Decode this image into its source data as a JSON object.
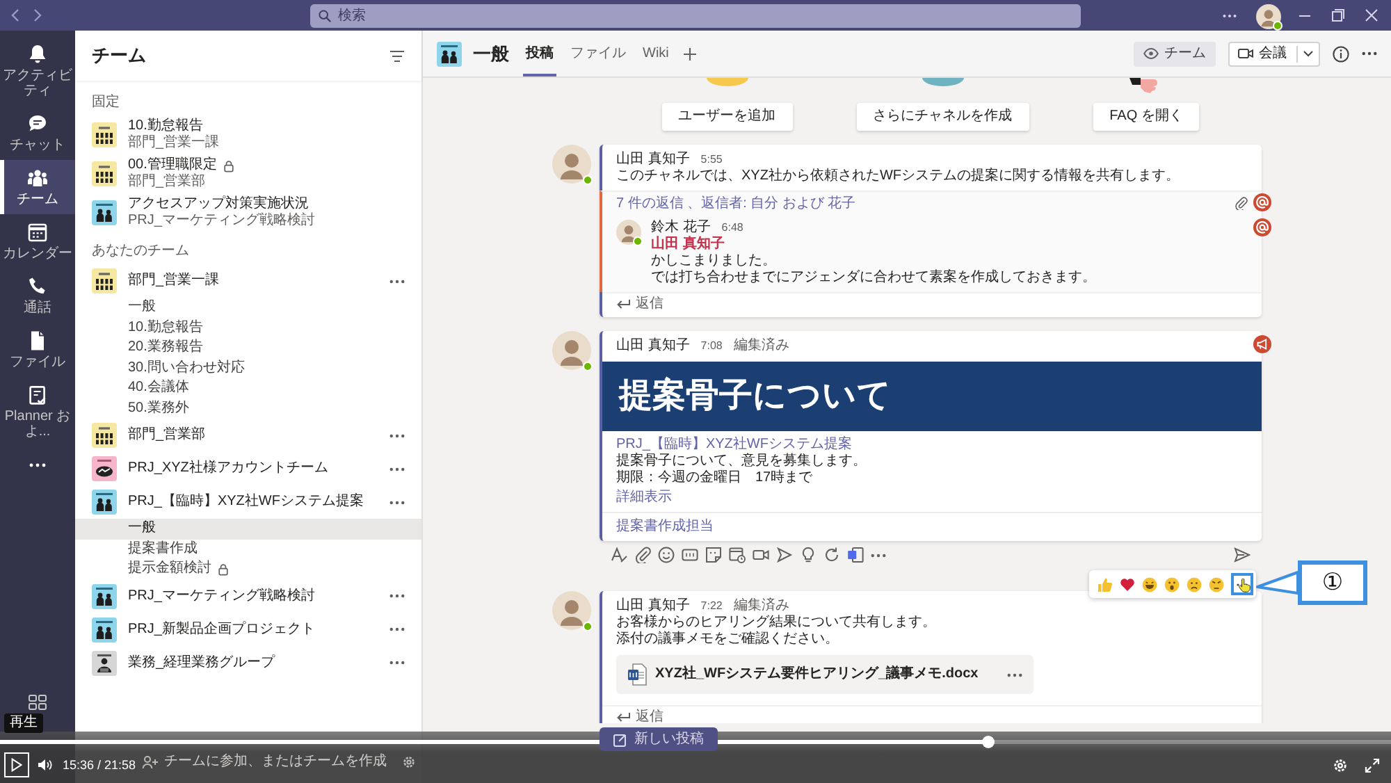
{
  "title_bar": {
    "search": {
      "placeholder": "検索"
    },
    "user": {
      "online": true
    }
  },
  "rail": {
    "items": [
      {
        "kind": "activity",
        "label": "アクティビティ",
        "selected": false
      },
      {
        "kind": "chat",
        "label": "チャット",
        "selected": false
      },
      {
        "kind": "teams",
        "label": "チーム",
        "selected": true
      },
      {
        "kind": "calendar",
        "label": "カレンダー",
        "selected": false
      },
      {
        "kind": "calls",
        "label": "通話",
        "selected": false
      },
      {
        "kind": "files",
        "label": "ファイル",
        "selected": false
      },
      {
        "kind": "planner",
        "label": "Planner およ...",
        "selected": false
      }
    ]
  },
  "sidebar": {
    "title": "チーム",
    "pinned_heading": "固定",
    "pinned": [
      {
        "kind": "people",
        "name": "10.勤怠報告",
        "team": "部門_営業一課",
        "locked": false
      },
      {
        "kind": "people",
        "name": "00.管理職限定",
        "team": "部門_営業部",
        "locked": true
      },
      {
        "kind": "figure",
        "name": "アクセスアップ対策実施状況",
        "team": "PRJ_マーケティング戦略検討",
        "locked": false
      }
    ],
    "teams_heading": "あなたのチーム",
    "teams": [
      {
        "kind": "people",
        "name": "部門_営業一課",
        "channels": [
          {
            "name": "一般",
            "selected": false,
            "locked": false
          },
          {
            "name": "10.勤怠報告",
            "selected": false,
            "locked": false
          },
          {
            "name": "20.業務報告",
            "selected": false,
            "locked": false
          },
          {
            "name": "30.問い合わせ対応",
            "selected": false,
            "locked": false
          },
          {
            "name": "40.会議体",
            "selected": false,
            "locked": false
          },
          {
            "name": "50.業務外",
            "selected": false,
            "locked": false
          }
        ]
      },
      {
        "kind": "people",
        "name": "部門_営業部"
      },
      {
        "kind": "handshake",
        "name": "PRJ_XYZ社様アカウントチーム"
      },
      {
        "kind": "figure",
        "name": "PRJ_【臨時】XYZ社WFシステム提案",
        "channels": [
          {
            "name": "一般",
            "selected": true,
            "locked": false
          },
          {
            "name": "提案書作成",
            "selected": false,
            "locked": false
          },
          {
            "name": "提示金額検討",
            "selected": false,
            "locked": true
          }
        ]
      },
      {
        "kind": "figure",
        "name": "PRJ_マーケティング戦略検討"
      },
      {
        "kind": "figure",
        "name": "PRJ_新製品企画プロジェクト"
      },
      {
        "kind": "person",
        "name": "業務_経理業務グループ"
      }
    ],
    "footer": "チームに参加、またはチームを作成"
  },
  "channel_header": {
    "kind": "figure",
    "name": "一般",
    "tabs": [
      {
        "label": "投稿",
        "selected": true
      },
      {
        "label": "ファイル",
        "selected": false
      },
      {
        "label": "Wiki",
        "selected": false
      }
    ],
    "team_button": "チーム",
    "meet_button": "会議"
  },
  "welcome": {
    "buttons": [
      "ユーザーを追加",
      "さらにチャネルを作成",
      "FAQ を開く"
    ]
  },
  "posts": [
    {
      "author": "山田 真知子",
      "online": true,
      "time": "5:55",
      "mentioned": true,
      "has_files": true,
      "announcement": false,
      "hovered": false,
      "lines": [
        "このチャネルでは、XYZ社から依頼されたWFシステムの提案に関する情報を共有します。"
      ],
      "replies_summary": "7 件の返信 、返信者: 自分 および 花子",
      "replies": [
        {
          "author": "鈴木 花子",
          "online": true,
          "time": "6:48",
          "mentioned": true,
          "mention": "山田 真知子",
          "lines": [
            "かしこまりました。",
            "では打ち合わせまでにアジェンダに合わせて素案を作成しておきます。"
          ]
        }
      ],
      "reply_label": "返信"
    },
    {
      "author": "山田 真知子",
      "online": true,
      "time": "7:08",
      "edited": "編集済み",
      "mentioned": false,
      "has_files": false,
      "announcement": true,
      "hovered": false,
      "headline": "提案骨子について",
      "team_link": "PRJ_【臨時】XYZ社WFシステム提案",
      "lines": [
        "提案骨子について、意見を募集します。",
        "期限：今週の金曜日　17時まで"
      ],
      "see_more": "詳細表示",
      "reply_draft": "提案書作成担当"
    },
    {
      "author": "山田 真知子",
      "online": true,
      "time": "7:22",
      "edited": "編集済み",
      "mentioned": false,
      "has_files": false,
      "announcement": false,
      "hovered": true,
      "lines": [
        "お客様からのヒアリング結果について共有します。",
        "添付の議事メモをご確認ください。"
      ],
      "file": {
        "name": "XYZ社_WFシステム要件ヒアリング_議事メモ.docx"
      },
      "reply_label": "返信"
    }
  ],
  "new_post_button": "新しい投稿",
  "annotation": {
    "label": "①"
  },
  "player": {
    "tooltip": "再生",
    "time": "15:36 / 21:58",
    "progress": {
      "level": 0.71
    }
  }
}
